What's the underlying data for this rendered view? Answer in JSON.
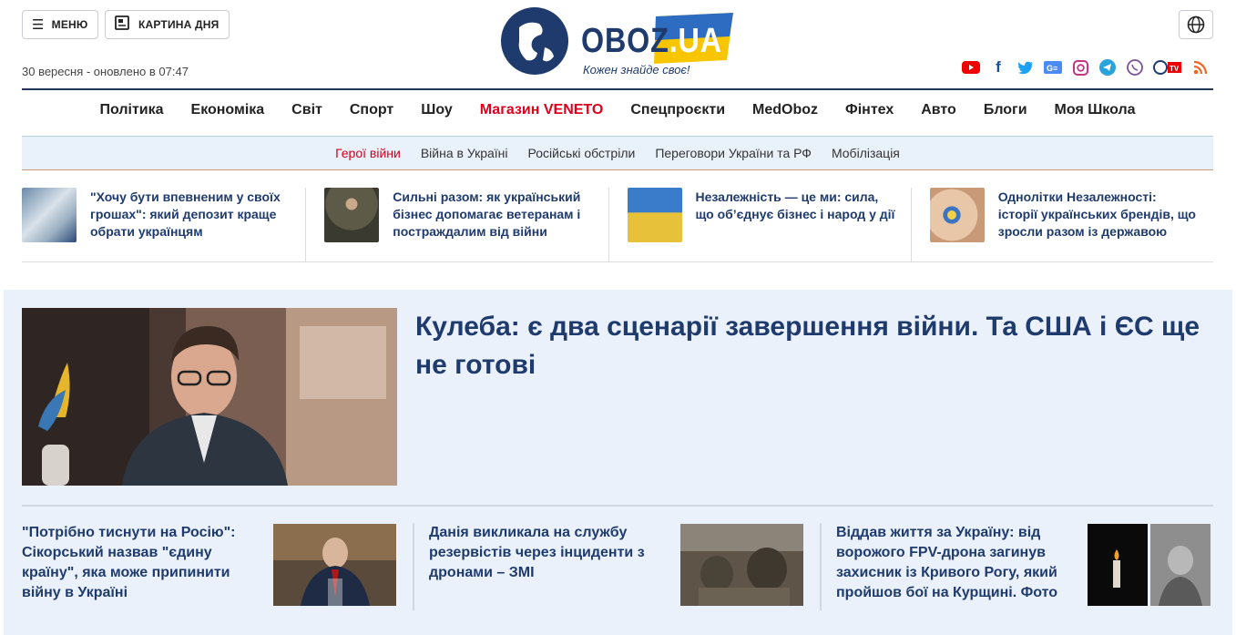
{
  "header": {
    "menu_label": "МЕНЮ",
    "picture_label": "КАРТИНА ДНЯ",
    "date": "30 вересня - оновлено в 07:47",
    "logo_text": "OBOZ",
    "logo_suffix": ".UA",
    "slogan": "Кожен знайде своє!",
    "social": [
      "youtube-icon",
      "facebook-icon",
      "twitter-icon",
      "google-news-icon",
      "instagram-icon",
      "telegram-icon",
      "viber-icon",
      "obozrevatel-tv-icon",
      "rss-icon"
    ]
  },
  "nav": {
    "items": [
      "Політика",
      "Економіка",
      "Світ",
      "Спорт",
      "Шоу",
      "Магазин VENETO",
      "Спецпроєкти",
      "MedOboz",
      "Фінтех",
      "Авто",
      "Блоги",
      "Моя Школа"
    ]
  },
  "subnav": {
    "items": [
      "Герої війни",
      "Війна в Україні",
      "Російські обстріли",
      "Переговори України та РФ",
      "Мобілізація"
    ]
  },
  "promos": [
    {
      "title": "\"Хочу бути впевненим у своїх грошах\": який депозит краще обрати українцям"
    },
    {
      "title": "Сильні разом: як український бізнес допомагає ветеранам і постраждалим від війни"
    },
    {
      "title": "Незалежність — це ми: сила, що об’єднує бізнес і народ у дії"
    },
    {
      "title": "Однолітки Незалежності: історії українських брендів, що зросли разом із державою"
    }
  ],
  "hero": {
    "title": "Кулеба: є два сценарії завершення війни. Та США і ЄС ще не готові"
  },
  "news": [
    {
      "title": "\"Потрібно тиснути на Росію\": Сікорський назвав \"єдину країну\", яка може припинити війну в Україні"
    },
    {
      "title": "Данія викликала на службу резервістів через інциденти з дронами – ЗМІ"
    },
    {
      "title": "Віддав життя за Україну: від ворожого FPV-дрона загинув захисник із Кривого Рогу, який пройшов бої на Курщині. Фото"
    }
  ],
  "colors": {
    "accent": "#1f3b6e",
    "red": "#e0001b",
    "bg_main": "#eaf1fa"
  }
}
